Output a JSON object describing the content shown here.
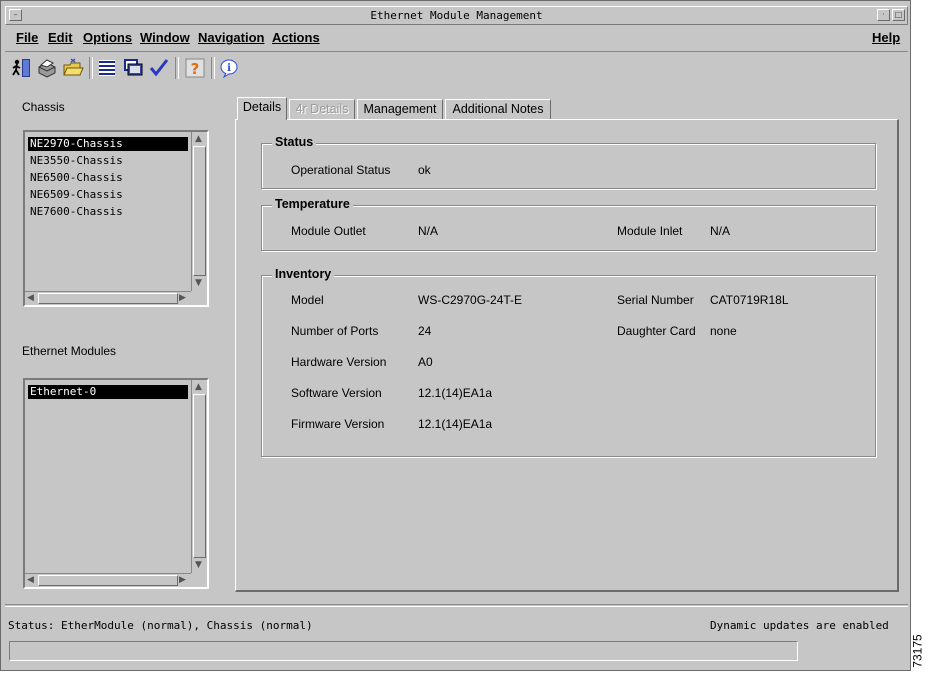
{
  "window": {
    "title": "Ethernet Module Management"
  },
  "menubar": {
    "items": [
      "File",
      "Edit",
      "Options",
      "Window",
      "Navigation",
      "Actions"
    ],
    "help": "Help"
  },
  "toolbar": {
    "icons": [
      "exit-icon",
      "print-icon",
      "open-folder-icon",
      "list-icon",
      "monitor-icon",
      "check-icon",
      "help-icon",
      "info-icon"
    ]
  },
  "chassis": {
    "label": "Chassis",
    "items": [
      "NE2970-Chassis",
      "NE3550-Chassis",
      "NE6500-Chassis",
      "NE6509-Chassis",
      "NE7600-Chassis"
    ],
    "selected": "NE2970-Chassis"
  },
  "modules": {
    "label": "Ethernet Modules",
    "items": [
      "Ethernet-0"
    ],
    "selected": "Ethernet-0"
  },
  "tabs": [
    {
      "label": "Details"
    },
    {
      "label": "4r Details"
    },
    {
      "label": "Management"
    },
    {
      "label": "Additional Notes"
    }
  ],
  "details": {
    "status": {
      "title": "Status",
      "op_label": "Operational Status",
      "op_value": "ok"
    },
    "temperature": {
      "title": "Temperature",
      "outlet_label": "Module Outlet",
      "outlet_value": "N/A",
      "inlet_label": "Module Inlet",
      "inlet_value": "N/A"
    },
    "inventory": {
      "title": "Inventory",
      "model_label": "Model",
      "model_value": "WS-C2970G-24T-E",
      "serial_label": "Serial Number",
      "serial_value": "CAT0719R18L",
      "ports_label": "Number of Ports",
      "ports_value": "24",
      "daughter_label": "Daughter Card",
      "daughter_value": "none",
      "hw_label": "Hardware Version",
      "hw_value": "A0",
      "sw_label": "Software Version",
      "sw_value": "12.1(14)EA1a",
      "fw_label": "Firmware Version",
      "fw_value": "12.1(14)EA1a"
    }
  },
  "statusbar": {
    "left": "Status: EtherModule (normal), Chassis (normal)",
    "right": "Dynamic updates are enabled"
  },
  "figure_number": "73175"
}
